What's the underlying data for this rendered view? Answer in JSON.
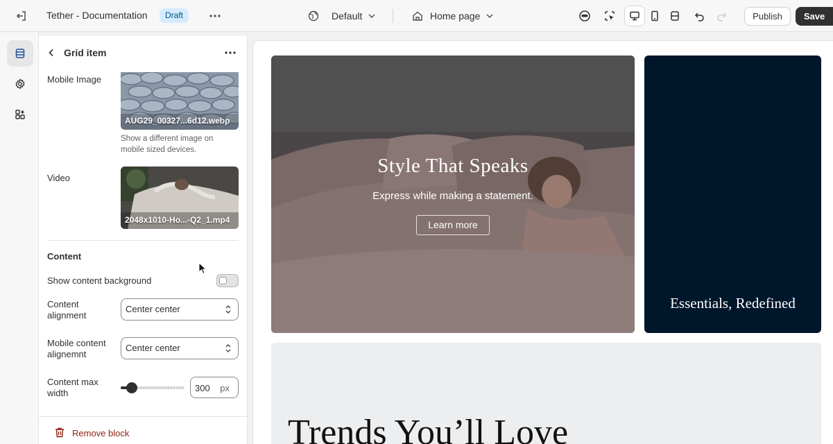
{
  "topbar": {
    "title": "Tether - Documentation",
    "badge": "Draft",
    "theme_selector": "Default",
    "page_selector": "Home page",
    "publish_label": "Publish",
    "save_label": "Save"
  },
  "panel": {
    "title": "Grid item",
    "mobile_image": {
      "label": "Mobile Image",
      "filename": "AUG29_00327...6d12.webp",
      "help": "Show a different image on mobile sized devices."
    },
    "video": {
      "label": "Video",
      "filename": "2048x1010-Ho...-Q2_1.mp4"
    },
    "content_section": {
      "title": "Content",
      "show_background_label": "Show content background",
      "show_background_on": false,
      "alignment_label": "Content alignment",
      "alignment_value": "Center center",
      "mobile_alignment_label": "Mobile content alignemnt",
      "mobile_alignment_value": "Center center",
      "max_width_label": "Content max width",
      "max_width_value": "300",
      "max_width_unit": "px"
    },
    "remove_label": "Remove block"
  },
  "preview": {
    "hero": {
      "title": "Style That Speaks",
      "subtitle": "Express while making a statement.",
      "button": "Learn more"
    },
    "side_card": {
      "title": "Essentials, Redefined",
      "background": "#00162b"
    },
    "trend_card": {
      "title": "Trends You’ll Love"
    }
  },
  "colors": {
    "accent_dark": "#303030",
    "badge_bg": "#d5ebff",
    "danger": "#8e1f0b"
  }
}
